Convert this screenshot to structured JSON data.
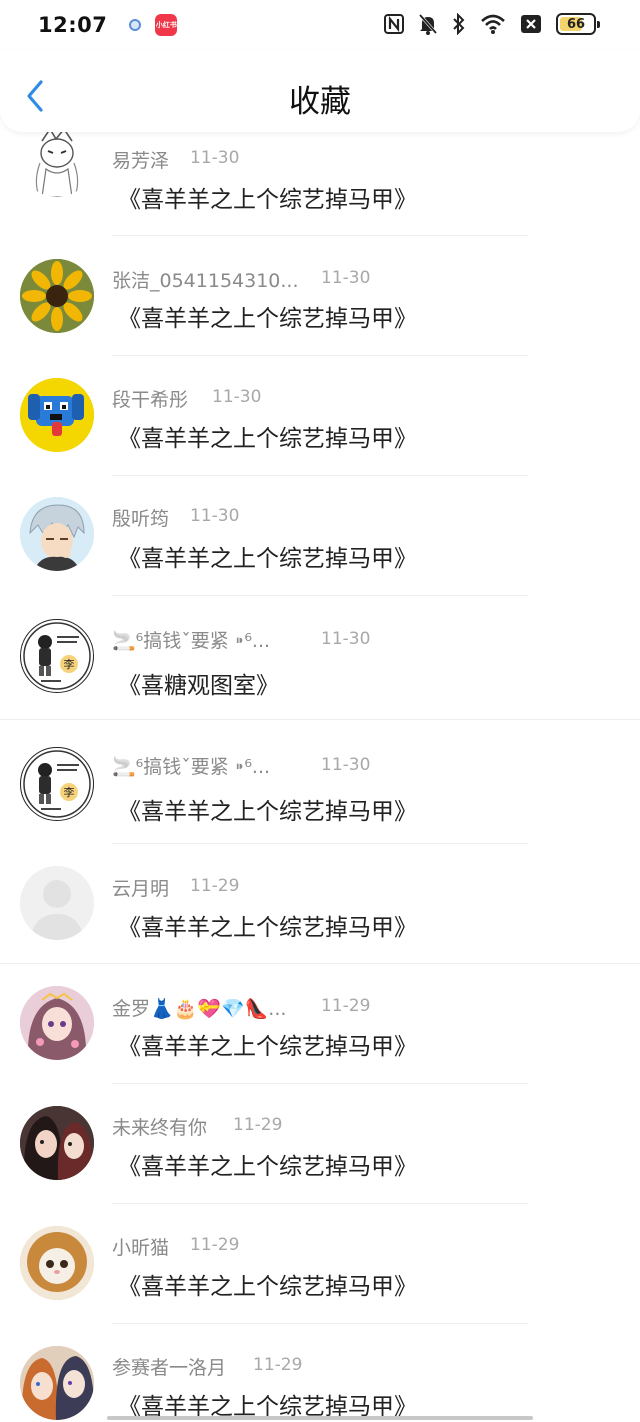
{
  "status_bar": {
    "time": "12:07",
    "app_badge": "小红书",
    "battery": "66"
  },
  "nav": {
    "title": "收藏"
  },
  "items": [
    {
      "name": "易芳泽",
      "date": "11-30",
      "title": "《喜羊羊之上个综艺掉马甲》",
      "avatar": "sketch-fox-girl"
    },
    {
      "name": "张洁_0541154310...",
      "date": "11-30",
      "title": "《喜羊羊之上个综艺掉马甲》",
      "avatar": "sunflower"
    },
    {
      "name": "段干希彤",
      "date": "11-30",
      "title": "《喜羊羊之上个综艺掉马甲》",
      "avatar": "pixel-dog"
    },
    {
      "name": "殷听筠",
      "date": "11-30",
      "title": "《喜羊羊之上个综艺掉马甲》",
      "avatar": "anime-silver-hair"
    },
    {
      "name": "🚬⁶搞钱ˇ要紧 ⁍⁶...",
      "date": "11-30",
      "title": "《喜糖观图室》",
      "avatar": "sticker-li"
    },
    {
      "name": "🚬⁶搞钱ˇ要紧 ⁍⁶...",
      "date": "11-30",
      "title": "《喜羊羊之上个综艺掉马甲》",
      "avatar": "sticker-li"
    },
    {
      "name": "云月明",
      "date": "11-29",
      "title": "《喜羊羊之上个综艺掉马甲》",
      "avatar": "default-user"
    },
    {
      "name": "金罗👗🎂💝💎👠...",
      "date": "11-29",
      "title": "《喜羊羊之上个综艺掉马甲》",
      "avatar": "anime-pink-girl"
    },
    {
      "name": "未来终有你",
      "date": "11-29",
      "title": "《喜羊羊之上个综艺掉马甲》",
      "avatar": "anime-dark-couple"
    },
    {
      "name": "小昕猫",
      "date": "11-29",
      "title": "《喜羊羊之上个综艺掉马甲》",
      "avatar": "lion-cat"
    },
    {
      "name": "参赛者一洛月",
      "date": "11-29",
      "title": "《喜羊羊之上个综艺掉马甲》",
      "avatar": "anime-boys"
    }
  ],
  "colors": {
    "accent": "#2f8ae8",
    "name_text": "#8a8a8a",
    "date_text": "#a8a8a8"
  }
}
